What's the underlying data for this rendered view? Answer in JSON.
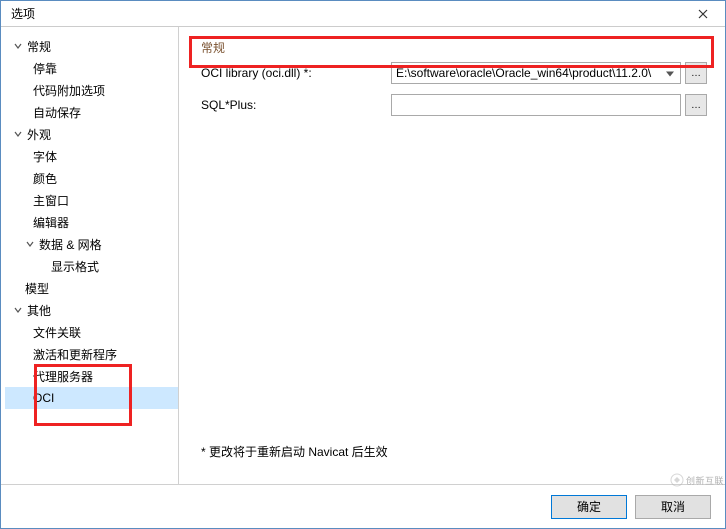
{
  "window": {
    "title": "选项"
  },
  "sidebar": {
    "general": "常规",
    "general_children": {
      "docking": "停靠",
      "code_addon": "代码附加选项",
      "autosave": "自动保存"
    },
    "appearance": "外观",
    "appearance_children": {
      "font": "字体",
      "color": "颜色",
      "main_window": "主窗口",
      "editor": "编辑器"
    },
    "data_grid": "数据 & 网格",
    "data_grid_children": {
      "display_format": "显示格式"
    },
    "model": "模型",
    "other": "其他",
    "other_children": {
      "file_assoc": "文件关联",
      "activation": "激活和更新程序",
      "proxy": "代理服务器",
      "oci": "OCI"
    }
  },
  "main": {
    "header": "常规",
    "oci_library_label": "OCI library (oci.dll) *:",
    "oci_library_value": "E:\\software\\oracle\\Oracle_win64\\product\\11.2.0\\",
    "sqlplus_label": "SQL*Plus:",
    "sqlplus_value": "",
    "note": "* 更改将于重新启动 Navicat 后生效"
  },
  "footer": {
    "ok": "确定",
    "cancel": "取消"
  },
  "watermark": "创新互联"
}
